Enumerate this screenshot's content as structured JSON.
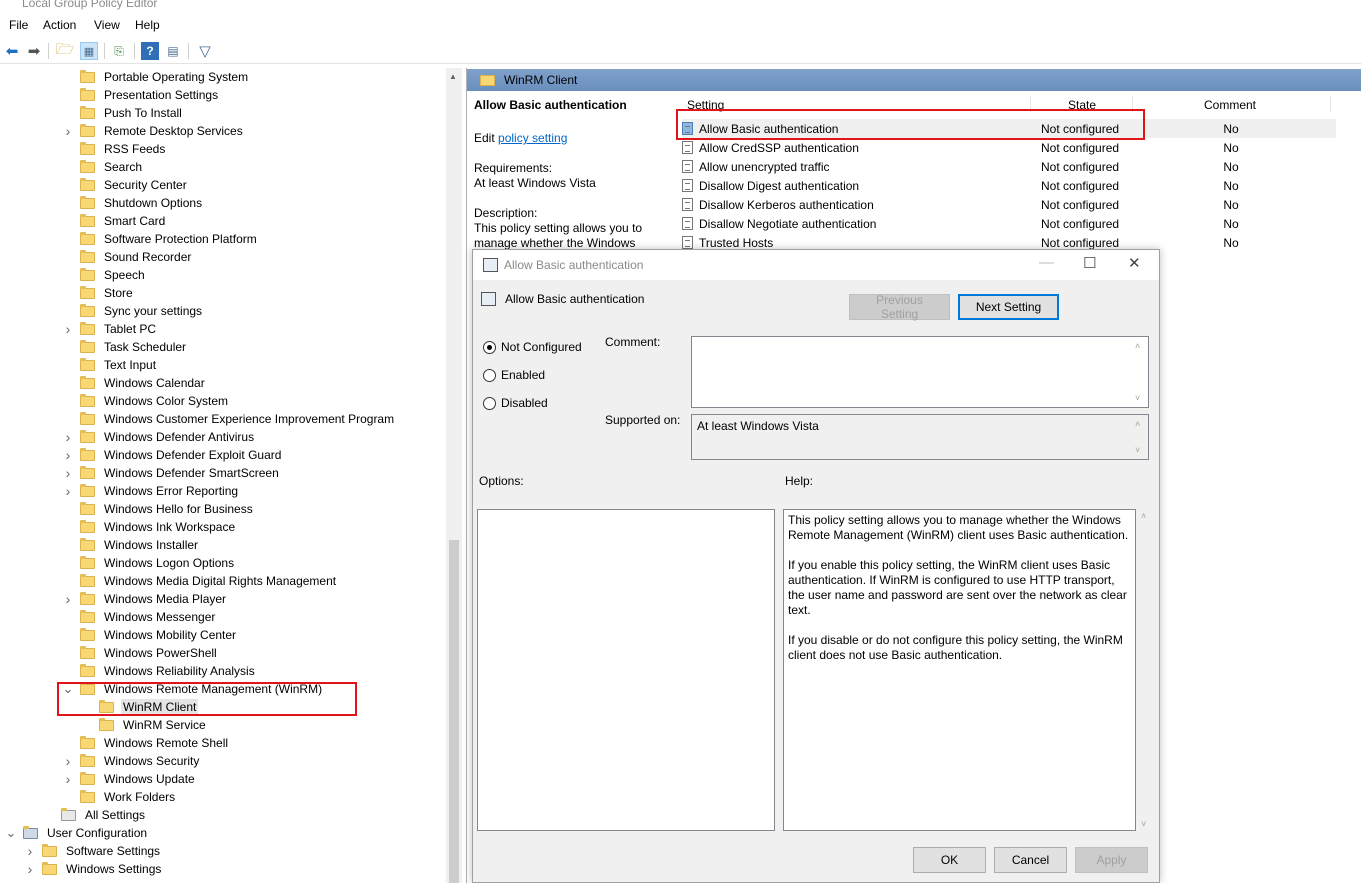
{
  "window": {
    "title": "Local Group Policy Editor"
  },
  "menu": [
    "File",
    "Action",
    "View",
    "Help"
  ],
  "tree": [
    {
      "label": "Portable Operating System",
      "expand": false
    },
    {
      "label": "Presentation Settings",
      "expand": false
    },
    {
      "label": "Push To Install",
      "expand": false
    },
    {
      "label": "Remote Desktop Services",
      "expand": true
    },
    {
      "label": "RSS Feeds",
      "expand": false
    },
    {
      "label": "Search",
      "expand": false
    },
    {
      "label": "Security Center",
      "expand": false
    },
    {
      "label": "Shutdown Options",
      "expand": false
    },
    {
      "label": "Smart Card",
      "expand": false
    },
    {
      "label": "Software Protection Platform",
      "expand": false
    },
    {
      "label": "Sound Recorder",
      "expand": false
    },
    {
      "label": "Speech",
      "expand": false
    },
    {
      "label": "Store",
      "expand": false
    },
    {
      "label": "Sync your settings",
      "expand": false
    },
    {
      "label": "Tablet PC",
      "expand": true
    },
    {
      "label": "Task Scheduler",
      "expand": false
    },
    {
      "label": "Text Input",
      "expand": false
    },
    {
      "label": "Windows Calendar",
      "expand": false
    },
    {
      "label": "Windows Color System",
      "expand": false
    },
    {
      "label": "Windows Customer Experience Improvement Program",
      "expand": false
    },
    {
      "label": "Windows Defender Antivirus",
      "expand": true
    },
    {
      "label": "Windows Defender Exploit Guard",
      "expand": true
    },
    {
      "label": "Windows Defender SmartScreen",
      "expand": true
    },
    {
      "label": "Windows Error Reporting",
      "expand": true
    },
    {
      "label": "Windows Hello for Business",
      "expand": false
    },
    {
      "label": "Windows Ink Workspace",
      "expand": false
    },
    {
      "label": "Windows Installer",
      "expand": false
    },
    {
      "label": "Windows Logon Options",
      "expand": false
    },
    {
      "label": "Windows Media Digital Rights Management",
      "expand": false
    },
    {
      "label": "Windows Media Player",
      "expand": true
    },
    {
      "label": "Windows Messenger",
      "expand": false
    },
    {
      "label": "Windows Mobility Center",
      "expand": false
    },
    {
      "label": "Windows PowerShell",
      "expand": false
    },
    {
      "label": "Windows Reliability Analysis",
      "expand": false
    },
    {
      "label": "Windows Remote Management (WinRM)",
      "expand": "open"
    },
    {
      "label": "WinRM Client",
      "expand": false,
      "child": true,
      "selected": true
    },
    {
      "label": "WinRM Service",
      "expand": false,
      "child": true
    },
    {
      "label": "Windows Remote Shell",
      "expand": false
    },
    {
      "label": "Windows Security",
      "expand": true
    },
    {
      "label": "Windows Update",
      "expand": true
    },
    {
      "label": "Work Folders",
      "expand": false
    },
    {
      "label": "All Settings",
      "expand": false,
      "allsettings": true
    },
    {
      "label": "User Configuration",
      "expand": "open",
      "root": true
    },
    {
      "label": "Software Settings",
      "expand": true,
      "level1": true
    },
    {
      "label": "Windows Settings",
      "expand": true,
      "level1": true
    }
  ],
  "right": {
    "header": "WinRM Client",
    "desc_title": "Allow Basic authentication",
    "edit_prefix": "Edit ",
    "edit_link": "policy setting",
    "req_label": "Requirements:",
    "req_value": "At least Windows Vista",
    "desc_label": "Description:",
    "desc_text": "This policy setting allows you to manage whether the Windows",
    "columns": {
      "setting": "Setting",
      "state": "State",
      "comment": "Comment"
    },
    "rows": [
      {
        "setting": "Allow Basic authentication",
        "state": "Not configured",
        "comment": "No"
      },
      {
        "setting": "Allow CredSSP authentication",
        "state": "Not configured",
        "comment": "No"
      },
      {
        "setting": "Allow unencrypted traffic",
        "state": "Not configured",
        "comment": "No"
      },
      {
        "setting": "Disallow Digest authentication",
        "state": "Not configured",
        "comment": "No"
      },
      {
        "setting": "Disallow Kerberos authentication",
        "state": "Not configured",
        "comment": "No"
      },
      {
        "setting": "Disallow Negotiate authentication",
        "state": "Not configured",
        "comment": "No"
      },
      {
        "setting": "Trusted Hosts",
        "state": "Not configured",
        "comment": "No"
      }
    ]
  },
  "dialog": {
    "title": "Allow Basic authentication",
    "subtitle": "Allow Basic authentication",
    "prev": "Previous Setting",
    "next": "Next Setting",
    "radios": [
      "Not Configured",
      "Enabled",
      "Disabled"
    ],
    "comment_label": "Comment:",
    "supported_label": "Supported on:",
    "supported_value": "At least Windows Vista",
    "options_label": "Options:",
    "help_label": "Help:",
    "help": [
      "This policy setting allows you to manage whether the Windows Remote Management (WinRM) client uses Basic authentication.",
      "If you enable this policy setting, the WinRM client uses Basic authentication. If WinRM is configured to use HTTP transport, the user name and password are sent over the network as clear text.",
      "If you disable or do not configure this policy setting, the WinRM client does not use Basic authentication."
    ],
    "ok": "OK",
    "cancel": "Cancel",
    "apply": "Apply"
  }
}
